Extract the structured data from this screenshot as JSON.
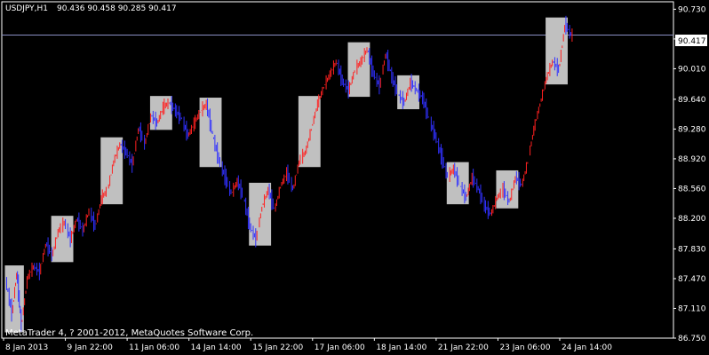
{
  "window": {
    "symbol_label": "USDJPY,H1",
    "ohlc_label": "90.436 90.458 90.285 90.417",
    "copyright": "MetaTrader 4, ? 2001-2012, MetaQuotes Software Corp."
  },
  "colors": {
    "background": "#000000",
    "frame": "#ffffff",
    "bull_bar": "#ff2020",
    "bear_bar": "#3030ff",
    "box_fill": "#c0c0c0",
    "bid_line": "#8a8fc4",
    "price_tag_bg": "#ffffff",
    "price_tag_text": "#000000"
  },
  "chart_data": {
    "type": "line",
    "title": "USDJPY,H1",
    "current_price": "90.417",
    "ylim": [
      86.75,
      90.82
    ],
    "xlim": [
      0,
      36
    ],
    "y_ticks": [
      "90.730",
      "90.370",
      "90.010",
      "89.640",
      "89.280",
      "88.920",
      "88.560",
      "88.200",
      "87.830",
      "87.470",
      "87.110",
      "86.750"
    ],
    "x_ticks": [
      {
        "x": 0,
        "label": "8 Jan 2013"
      },
      {
        "x": 4,
        "label": "9 Jan 22:00"
      },
      {
        "x": 8,
        "label": "11 Jan 06:00"
      },
      {
        "x": 12,
        "label": "14 Jan 14:00"
      },
      {
        "x": 16,
        "label": "15 Jan 22:00"
      },
      {
        "x": 20,
        "label": "17 Jan 06:00"
      },
      {
        "x": 24,
        "label": "18 Jan 14:00"
      },
      {
        "x": 28,
        "label": "21 Jan 22:00"
      },
      {
        "x": 32,
        "label": "23 Jan 06:00"
      },
      {
        "x": 36,
        "label": "24 Jan 14:00"
      }
    ],
    "series": [
      {
        "values": [
          [
            0.2,
            87.45
          ],
          [
            0.6,
            87.05
          ],
          [
            0.9,
            87.55
          ],
          [
            1.2,
            86.9
          ],
          [
            1.6,
            87.48
          ],
          [
            2.0,
            87.62
          ],
          [
            2.4,
            87.55
          ],
          [
            2.8,
            87.9
          ],
          [
            3.2,
            87.75
          ],
          [
            3.6,
            88.05
          ],
          [
            4.0,
            88.15
          ],
          [
            4.4,
            87.95
          ],
          [
            4.8,
            88.2
          ],
          [
            5.2,
            88.05
          ],
          [
            5.6,
            88.3
          ],
          [
            6.0,
            88.1
          ],
          [
            6.4,
            88.45
          ],
          [
            6.8,
            88.55
          ],
          [
            7.2,
            88.9
          ],
          [
            7.6,
            89.1
          ],
          [
            8.0,
            89.0
          ],
          [
            8.4,
            88.85
          ],
          [
            8.8,
            89.3
          ],
          [
            9.2,
            89.1
          ],
          [
            9.6,
            89.45
          ],
          [
            10.0,
            89.35
          ],
          [
            10.4,
            89.55
          ],
          [
            10.8,
            89.6
          ],
          [
            11.2,
            89.5
          ],
          [
            11.6,
            89.4
          ],
          [
            12.0,
            89.2
          ],
          [
            12.4,
            89.35
          ],
          [
            12.8,
            89.5
          ],
          [
            13.2,
            89.58
          ],
          [
            13.6,
            89.2
          ],
          [
            14.0,
            88.9
          ],
          [
            14.4,
            88.7
          ],
          [
            14.8,
            88.5
          ],
          [
            15.2,
            88.65
          ],
          [
            15.6,
            88.45
          ],
          [
            16.0,
            88.1
          ],
          [
            16.4,
            87.95
          ],
          [
            16.8,
            88.35
          ],
          [
            17.2,
            88.55
          ],
          [
            17.6,
            88.3
          ],
          [
            18.0,
            88.6
          ],
          [
            18.4,
            88.75
          ],
          [
            18.8,
            88.55
          ],
          [
            19.2,
            88.9
          ],
          [
            19.6,
            89.0
          ],
          [
            20.0,
            89.3
          ],
          [
            20.4,
            89.6
          ],
          [
            20.8,
            89.8
          ],
          [
            21.2,
            89.95
          ],
          [
            21.6,
            90.1
          ],
          [
            22.0,
            89.85
          ],
          [
            22.4,
            89.75
          ],
          [
            22.8,
            90.0
          ],
          [
            23.2,
            90.1
          ],
          [
            23.6,
            90.25
          ],
          [
            24.0,
            89.95
          ],
          [
            24.4,
            89.8
          ],
          [
            24.8,
            90.2
          ],
          [
            25.2,
            89.9
          ],
          [
            25.6,
            89.7
          ],
          [
            26.0,
            89.6
          ],
          [
            26.4,
            89.85
          ],
          [
            26.8,
            89.75
          ],
          [
            27.2,
            89.65
          ],
          [
            27.6,
            89.4
          ],
          [
            28.0,
            89.2
          ],
          [
            28.4,
            88.95
          ],
          [
            28.8,
            88.7
          ],
          [
            29.2,
            88.8
          ],
          [
            29.6,
            88.6
          ],
          [
            30.0,
            88.45
          ],
          [
            30.4,
            88.7
          ],
          [
            30.8,
            88.55
          ],
          [
            31.2,
            88.35
          ],
          [
            31.6,
            88.25
          ],
          [
            32.0,
            88.45
          ],
          [
            32.4,
            88.55
          ],
          [
            32.8,
            88.4
          ],
          [
            33.2,
            88.7
          ],
          [
            33.6,
            88.6
          ],
          [
            34.0,
            88.9
          ],
          [
            34.4,
            89.3
          ],
          [
            34.8,
            89.6
          ],
          [
            35.2,
            89.9
          ],
          [
            35.6,
            90.1
          ],
          [
            36.0,
            90.0
          ],
          [
            36.4,
            90.55
          ],
          [
            36.8,
            90.417
          ]
        ]
      }
    ]
  }
}
